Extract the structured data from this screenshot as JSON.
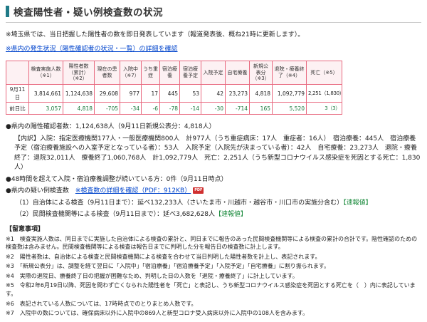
{
  "page": {
    "title": "検査陽性者・疑い例検査数の状況",
    "intro_note": "※埼玉県では、当日把握した陽性者の数を即日発表しています（報道発表後、概ね21時に更新します）。",
    "status_link": "※県内の発生状況（陽性確認者の状況・一覧）の詳細を確認"
  },
  "table": {
    "row_label_header": "",
    "columns": [
      "検査実施人数（※1）",
      "陽性者数（累計）（※2）",
      "現在の患者数",
      "入院中（※7）",
      "うち重症",
      "宿泊療養",
      "宿泊療養予定",
      "入院予定",
      "自宅療養",
      "新規公表分（※3）",
      "退院・療養終了（※4）",
      "死亡（※5）"
    ],
    "rows": [
      {
        "label": "9月11日",
        "values": [
          "3,814,661",
          "1,124,638",
          "29,608",
          "977",
          "17",
          "445",
          "53",
          "42",
          "23,273",
          "4,818",
          "1,092,779",
          "2,251（1,830）"
        ]
      },
      {
        "label": "前日比",
        "values": [
          "3,057",
          "4,818",
          "-705",
          "-34",
          "-6",
          "-78",
          "-14",
          "-30",
          "-714",
          "165",
          "5,520",
          "3（3）"
        ]
      }
    ]
  },
  "summary": {
    "positives_line": "●県内の陽性確認者数：1,124,638人（9月11日新規公表分：4,818人）",
    "breakdown": "【内訳】入院：指定医療機関177人・一般医療機関800人　計977人（うち重症病床：17人　重症者：16人）　宿泊療養：445人　宿泊療養予定（宿泊療養施設への入室予定となっている者）：53人　入院予定（入院先が決まっている者）：42人　自宅療養：23,273人　退院・療養終了：退院32,011人　療養終了1,060,768人　計1,092,779人　死亡：2,251人（うち新型コロナウイルス感染症を死因とする死亡：1,830人）",
    "adjustment_line": "●48時間を超えて入院・宿泊療養調整が続いている方：0件（9月11日時点）",
    "suspected_label": "●県内の疑い例検査数　",
    "pdf_link": "※検査数の詳細を確認（PDF：912KB）",
    "items": [
      {
        "text": "（1）自治体による検査（9月11日まで）：延べ132,233人（さいたま市・川越市・越谷市・川口市の実施分含む）",
        "badge": "【速報値】"
      },
      {
        "text": "（2）民間検査機関等による検査（9月11日まで）：延べ3,682,628人",
        "badge": "【速報値】"
      }
    ]
  },
  "notes": {
    "heading": "【留意事項】",
    "items": [
      "※1　検査実施人数は、同日までに実施した自治体による検査の累計と、同日までに報告のあった民間検査機関等による検査の累計の合計です。陰性確認のための検査数は含みません。民間検査機関等による検査は報告日までに判明した分を報告日の検査数に計上します。",
      "※2　陽性者数は、自治体による検査と民間検査機関による検査を合わせて当日判明した陽性者数を計上し、表記されます。",
      "※3　「新規公表分」は、調整を経て翌日に「入院中」「宿泊療養」「宿泊療養予定」「入院予定」「自宅療養」に割り振られます。",
      "※4　実際の退院日、療養終了日の把握が困難なため、判明した日の人数を「退院・療養終了」に計上しています。",
      "※5　令和2年6月19日以降、死因を問わず亡くなられた陽性者を「死亡」と表記し、うち新型コロナウイルス感染症を死因とする死亡を（　）内に表記しています。",
      "※6　表記されている人数については、17時時点でのとりまとめ人数です。",
      "※7　入院中の数については、確保病床以外に入院中の869人と新型コロナ受入病床以外に入院中の108人を含みます。"
    ]
  },
  "icons": {
    "pdf_label": "PDF"
  },
  "colors": {
    "accent_teal": "#1f7a87",
    "table_border": "#e8697f",
    "link_blue": "#0044cc",
    "delta_green": "#1a7a3c",
    "badge_green": "#1a8a3c",
    "pdf_red": "#d03030"
  }
}
